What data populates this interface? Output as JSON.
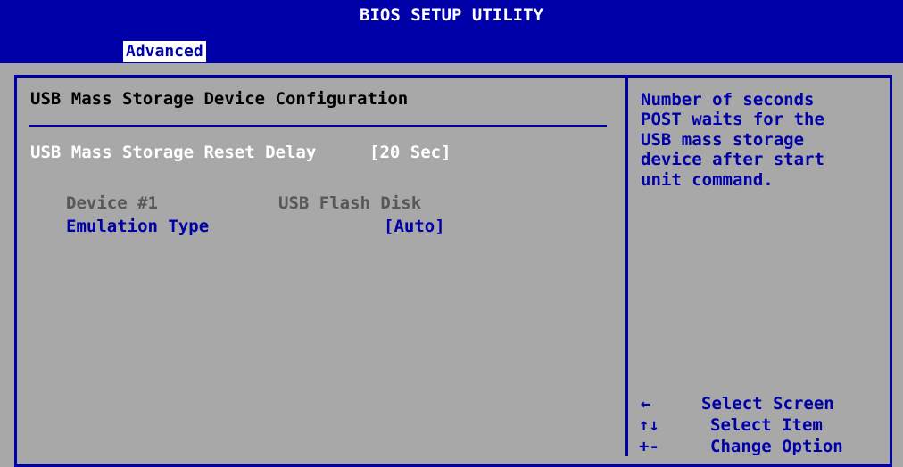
{
  "header": {
    "title": "BIOS SETUP UTILITY"
  },
  "tabs": [
    {
      "label": "Advanced",
      "active": true
    }
  ],
  "main": {
    "section_title": "USB Mass Storage Device Configuration",
    "reset_delay": {
      "label": "USB Mass Storage Reset Delay",
      "value": "[20 Sec]"
    },
    "device": {
      "label": "Device #1",
      "value": "USB Flash Disk"
    },
    "emulation": {
      "label": "Emulation Type",
      "value": "[Auto]"
    }
  },
  "help": {
    "lines": [
      "Number of seconds",
      "POST waits for the",
      "USB mass storage",
      "device after start",
      "unit command."
    ]
  },
  "keys": [
    {
      "key": "←",
      "desc": "Select Screen"
    },
    {
      "key": "↑↓",
      "desc": "Select Item"
    },
    {
      "key": "+-",
      "desc": "Change Option"
    }
  ],
  "colors": {
    "background": "#a8a8a8",
    "bar": "#0000a8",
    "highlight_text": "#ffffff",
    "selected_item": "#0000a8",
    "disabled_text": "#585858"
  }
}
